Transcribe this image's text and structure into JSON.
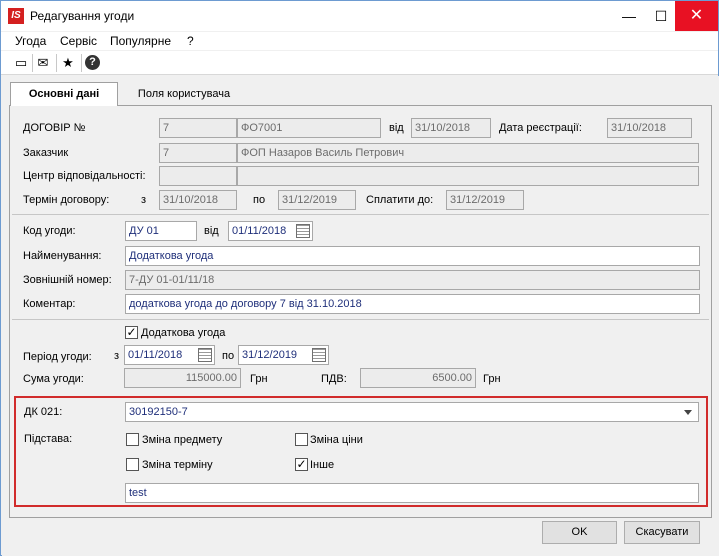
{
  "window": {
    "title": "Редагування угоди",
    "logo_text": "IS",
    "min_glyph": "—",
    "max_glyph": "☐",
    "close_glyph": "✕"
  },
  "menu": [
    "Угода",
    "Сервіс",
    "Популярне",
    "?"
  ],
  "toolbar_icons": [
    "new-document-icon",
    "mail-icon",
    "star-icon",
    "help-icon"
  ],
  "toolbar_glyphs": [
    "▭",
    "✉",
    "★",
    "?"
  ],
  "tabs": {
    "active": "Основні дані",
    "inactive": "Поля користувача"
  },
  "contract": {
    "label": "ДОГОВІР №",
    "code": "7",
    "number": "ФО7001",
    "date_label": "від",
    "date": "31/10/2018",
    "reg_label": "Дата реєстрації:",
    "reg_date": "31/10/2018"
  },
  "customer": {
    "label": "Заказчик",
    "code": "7",
    "name": "ФОП Назаров Василь Петрович"
  },
  "resp_center": {
    "label": "Центр відповідальності:",
    "code": "",
    "name": ""
  },
  "term": {
    "label": "Термін договору:",
    "from_label": "з",
    "from": "31/10/2018",
    "to_label": "по",
    "to": "31/12/2019",
    "pay_label": "Сплатити до:",
    "pay": "31/12/2019"
  },
  "agreement": {
    "code_label": "Код угоди:",
    "code": "ДУ 01",
    "date_label": "від",
    "date": "01/11/2018",
    "name_label": "Найменування:",
    "name": "Додаткова угода",
    "ext_label": "Зовнішній номер:",
    "ext": "7-ДУ 01-01/11/18",
    "comment_label": "Коментар:",
    "comment": "додаткова угода до договору 7 від 31.10.2018"
  },
  "additional": {
    "label": "Додаткова угода",
    "checked_glyph": "✓"
  },
  "period": {
    "label": "Період угоди:",
    "from_label": "з",
    "from": "01/11/2018",
    "to_label": "по",
    "to": "31/12/2019"
  },
  "sum": {
    "label": "Сума угоди:",
    "value": "115000.00",
    "currency": "Грн",
    "vat_label": "ПДВ:",
    "vat": "6500.00",
    "vat_currency": "Грн"
  },
  "dk": {
    "label": "ДК 021:",
    "value": "30192150-7"
  },
  "basis": {
    "label": "Підстава:",
    "options": [
      {
        "label": "Зміна предмету",
        "checked": false
      },
      {
        "label": "Зміна ціни",
        "checked": false
      },
      {
        "label": "Зміна терміну",
        "checked": false
      },
      {
        "label": "Інше",
        "checked": true
      }
    ],
    "other_text": "test",
    "checked_glyph": "✓"
  },
  "buttons": {
    "ok": "OK",
    "cancel": "Скасувати"
  }
}
